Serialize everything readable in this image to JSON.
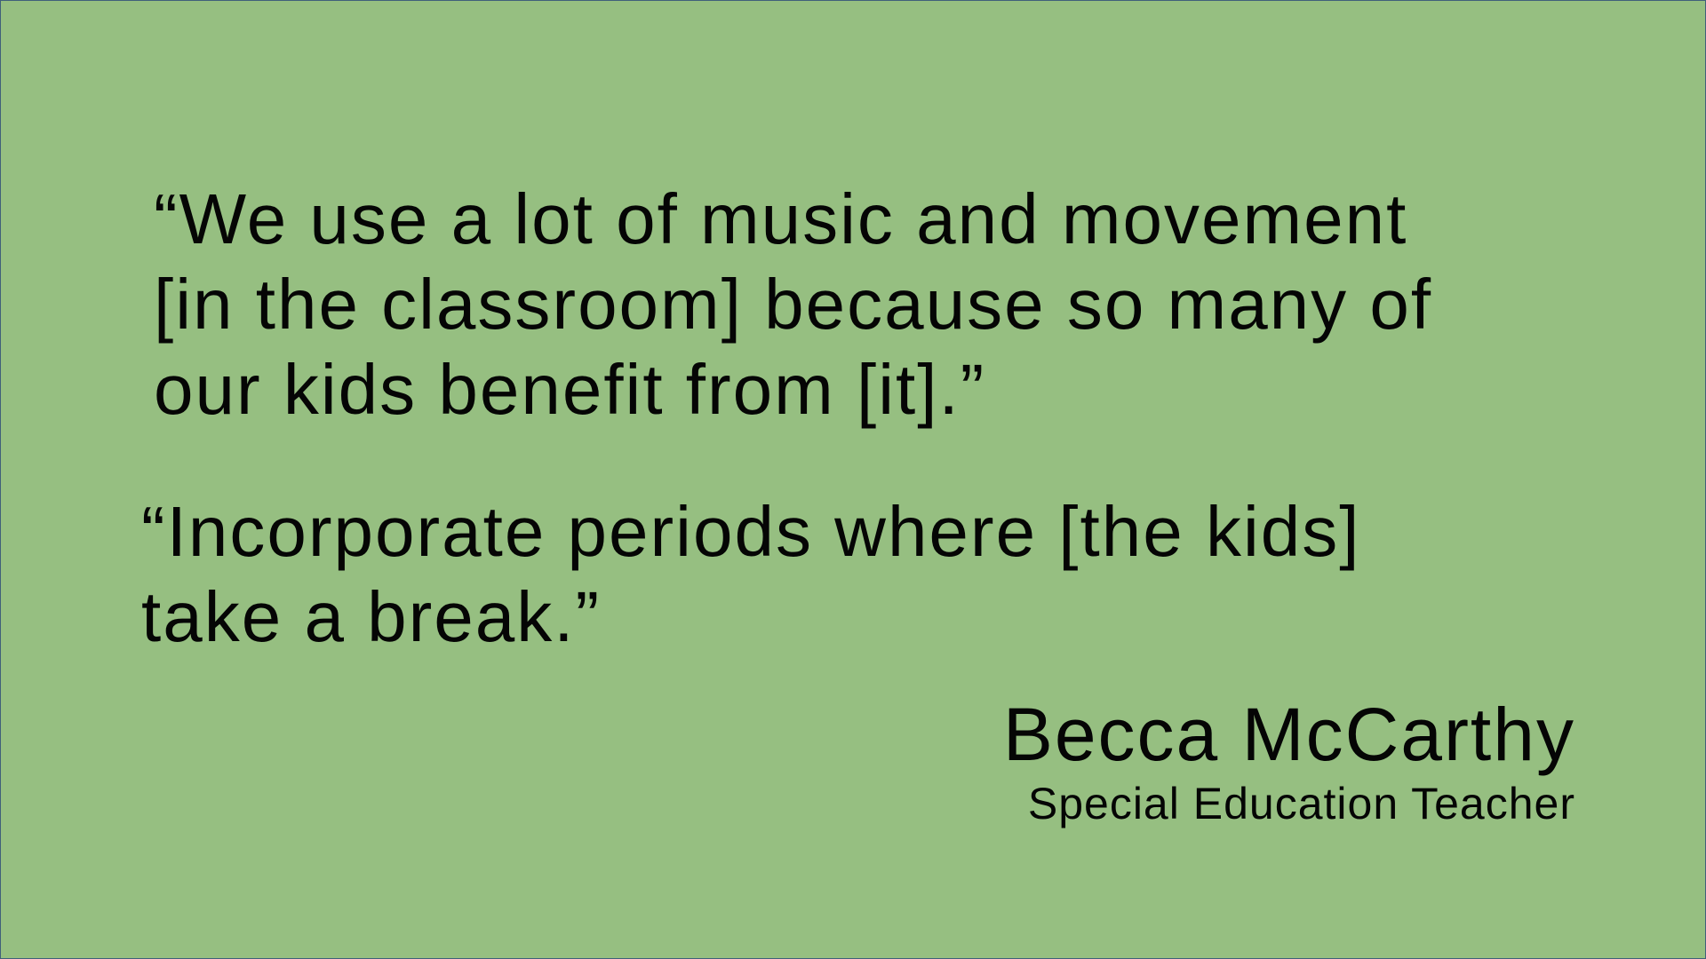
{
  "quotes": [
    {
      "lines": [
        "“We use a lot of music and movement",
        "[in the classroom] because so many of",
        "our kids benefit from [it].”"
      ]
    },
    {
      "lines": [
        "“Incorporate periods where [the kids]",
        "take a break.”"
      ]
    }
  ],
  "attribution": {
    "name": "Becca McCarthy",
    "title": "Special Education Teacher"
  },
  "colors": {
    "background": "#96bf81",
    "text": "#050505",
    "border": "#40607a"
  }
}
